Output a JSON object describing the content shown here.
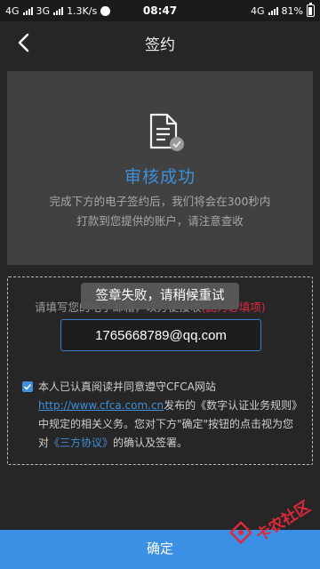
{
  "status_bar": {
    "network1": "4G",
    "network2": "3G",
    "speed": "1.3K/s",
    "time": "08:47",
    "network3": "4G",
    "battery": "81%"
  },
  "header": {
    "title": "签约"
  },
  "result": {
    "title": "审核成功",
    "desc_line1": "完成下方的电子签约后，我们将会在300秒内",
    "desc_line2": "打款到您提供的账户，请注意查收"
  },
  "form": {
    "email_prompt": "请填写您的电子邮箱，以方便接收",
    "required_label": "(此为必填项)",
    "email_value": "1765668789@qq.com",
    "agree_checked": true,
    "agree_text1": "本人已认真阅读并同意遵守CFCA网站",
    "agree_link": "http://www.cfca.com.cn",
    "agree_text2": "发布的《数字认证业务规则》",
    "agree_text3": "中规定的相关义务。您对下方\"确定\"按钮的点击视为您对",
    "protocol_link": "《三方协议》",
    "agree_text4": "的确认及签署。"
  },
  "toast": {
    "message": "签章失败，请稍候重试"
  },
  "footer": {
    "confirm_label": "确定"
  },
  "watermark": {
    "text": "卡农社区"
  },
  "colors": {
    "accent": "#3b8fe5",
    "required": "#e0263f",
    "background": "#262626"
  }
}
